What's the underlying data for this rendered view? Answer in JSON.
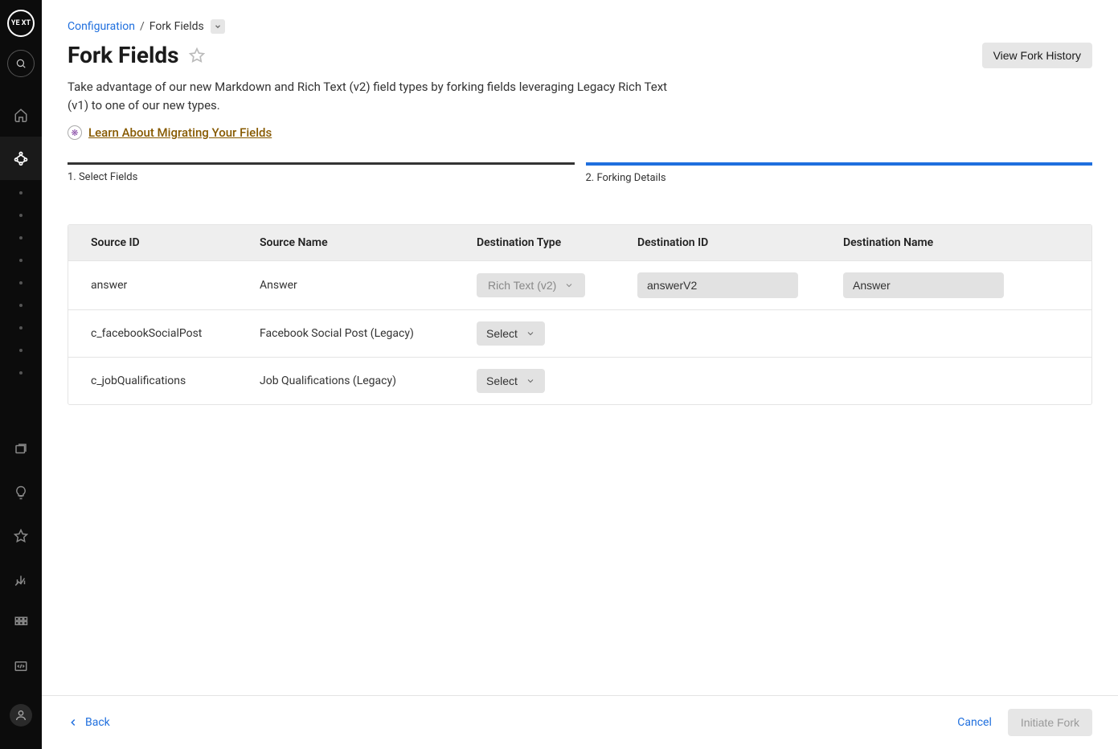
{
  "sidebar": {
    "logo_text": "YE\nXT"
  },
  "breadcrumb": {
    "root": "Configuration",
    "current": "Fork Fields"
  },
  "header": {
    "title": "Fork Fields",
    "view_history": "View Fork History"
  },
  "description": "Take advantage of our new Markdown and Rich Text (v2) field types by forking fields leveraging Legacy Rich Text (v1) to one of our new types.",
  "learn_link": "Learn About Migrating Your Fields",
  "stepper": {
    "step1": "1. Select Fields",
    "step2": "2. Forking Details"
  },
  "table": {
    "headers": {
      "source_id": "Source ID",
      "source_name": "Source Name",
      "dest_type": "Destination Type",
      "dest_id": "Destination ID",
      "dest_name": "Destination Name"
    },
    "rows": [
      {
        "source_id": "answer",
        "source_name": "Answer",
        "dest_type": "Rich Text (v2)",
        "dest_id": "answerV2",
        "dest_name": "Answer"
      },
      {
        "source_id": "c_facebookSocialPost",
        "source_name": "Facebook Social Post (Legacy)",
        "dest_type": "Select",
        "dest_id": "",
        "dest_name": ""
      },
      {
        "source_id": "c_jobQualifications",
        "source_name": "Job Qualifications (Legacy)",
        "dest_type": "Select",
        "dest_id": "",
        "dest_name": ""
      }
    ]
  },
  "footer": {
    "back": "Back",
    "cancel": "Cancel",
    "submit": "Initiate Fork"
  }
}
